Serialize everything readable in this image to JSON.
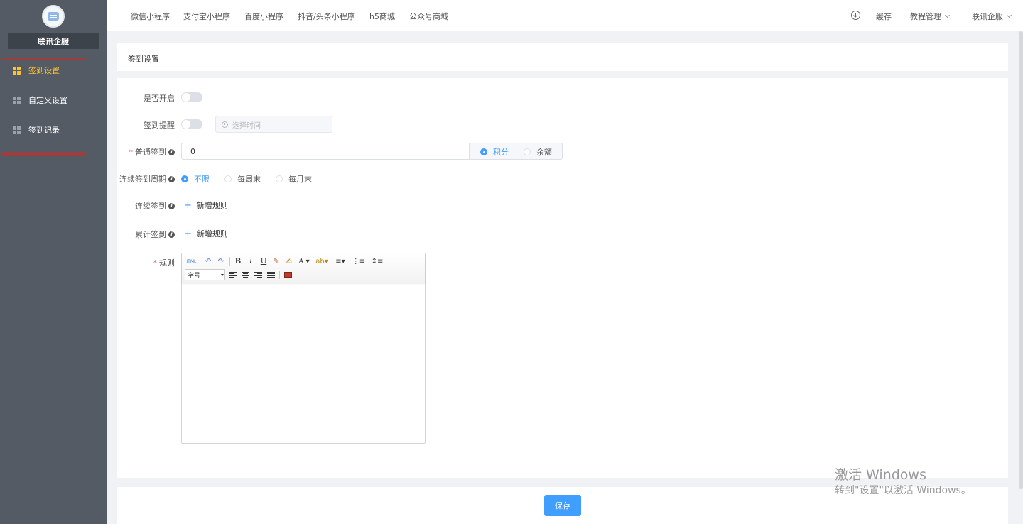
{
  "sidebar": {
    "brand": "联讯企服",
    "items": [
      {
        "label": "签到设置",
        "active": true
      },
      {
        "label": "自定义设置",
        "active": false
      },
      {
        "label": "签到记录",
        "active": false
      }
    ]
  },
  "topnav": {
    "tabs": [
      "微信小程序",
      "支付宝小程序",
      "百度小程序",
      "抖音/头条小程序",
      "h5商城",
      "公众号商城"
    ],
    "cache": "缓存",
    "tutorial": "教程管理",
    "account": "联讯企服"
  },
  "page": {
    "title": "签到设置"
  },
  "form": {
    "enable_label": "是否开启",
    "enable_on": false,
    "remind_label": "签到提醒",
    "remind_on": false,
    "time_placeholder": "选择时间",
    "normal_label": "普通签到",
    "normal_value": "0",
    "reward_options": [
      "积分",
      "余额"
    ],
    "reward_selected": "积分",
    "cycle_label": "连续签到周期",
    "cycle_options": [
      "不限",
      "每周末",
      "每月末"
    ],
    "cycle_selected": "不限",
    "continuous_label": "连续签到",
    "continuous_add": "新增规则",
    "cumulative_label": "累计签到",
    "cumulative_add": "新增规则",
    "rules_label": "规则",
    "editor": {
      "font_size_placeholder": "字号",
      "buttons": [
        "html",
        "undo",
        "redo",
        "bold",
        "italic",
        "underline",
        "eraser",
        "brush",
        "font-color",
        "highlight",
        "ordered-list",
        "unordered-list",
        "line-height",
        "align-left",
        "align-center",
        "align-right",
        "align-justify",
        "image"
      ]
    }
  },
  "footer": {
    "save": "保存"
  },
  "watermark": {
    "line1": "激活 Windows",
    "line2": "转到\"设置\"以激活 Windows。"
  },
  "colors": {
    "sidebar_bg": "#545b64",
    "active": "#ffc130",
    "primary": "#409eff",
    "highlight_box": "#e2231a"
  }
}
